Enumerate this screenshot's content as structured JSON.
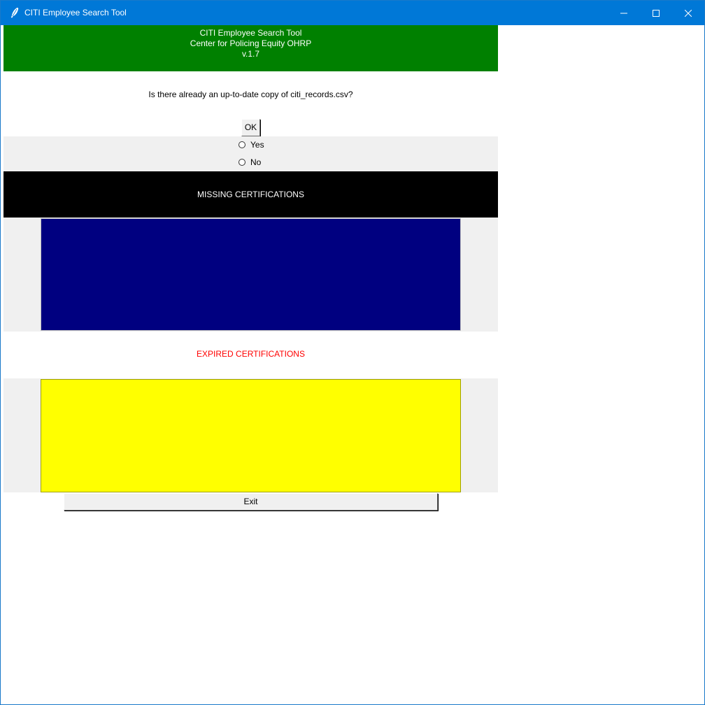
{
  "window": {
    "title": "CITI Employee Search Tool",
    "icon": "feather-icon",
    "controls": {
      "minimize_icon": "minimize-icon",
      "maximize_icon": "maximize-icon",
      "close_icon": "close-icon"
    }
  },
  "header": {
    "line1": "CITI Employee Search Tool",
    "line2": "Center for Policing Equity OHRP",
    "line3": "v.1.7",
    "background": "#008000"
  },
  "question": {
    "text": "Is there already an up-to-date copy of citi_records.csv?",
    "ok_label": "OK"
  },
  "radio": {
    "options": [
      {
        "label": "Yes",
        "selected": false
      },
      {
        "label": "No",
        "selected": false
      }
    ]
  },
  "missing": {
    "heading": "MISSING CERTIFICATIONS",
    "box_color": "#000080"
  },
  "expired": {
    "heading": "EXPIRED CERTIFICATIONS",
    "heading_color": "#ff0000",
    "box_color": "#ffff00"
  },
  "footer": {
    "exit_label": "Exit"
  }
}
